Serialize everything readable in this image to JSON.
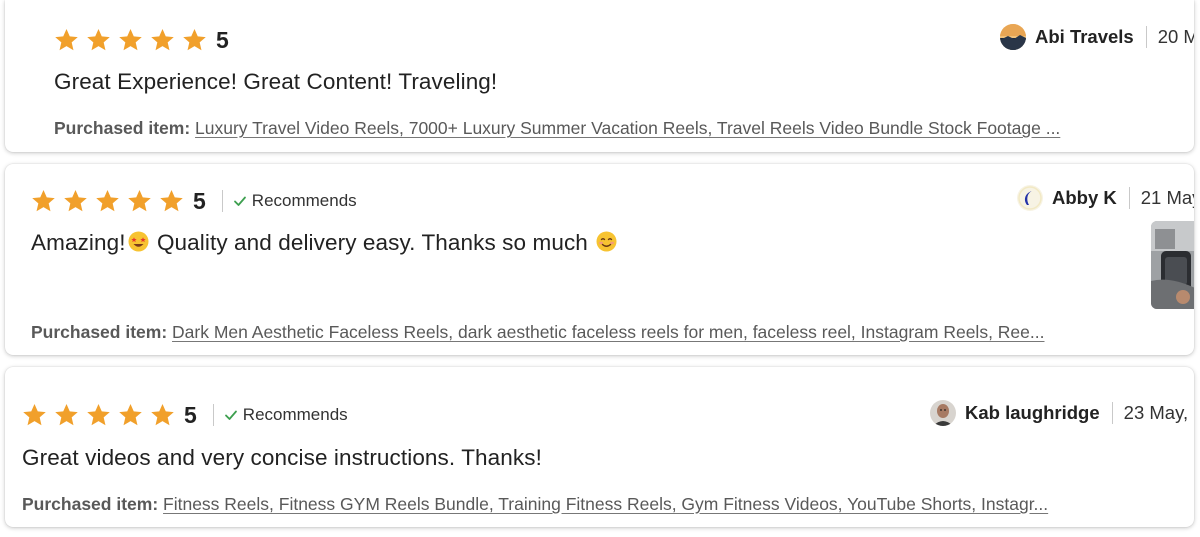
{
  "colors": {
    "star": "#F1A02B",
    "check": "#3d9f4f",
    "card_border": "#e1e1e1"
  },
  "icons": {
    "star": "star-icon",
    "check": "check-icon",
    "emoji_star_eyes": "star-struck-emoji-icon",
    "emoji_smile": "smiling-face-emoji-icon"
  },
  "reviews": [
    {
      "rating": 5,
      "rating_label": "5",
      "recommends": "",
      "text": "Great Experience! Great Content! Traveling!",
      "purchased_label": "Purchased item:",
      "purchased_item": "Luxury Travel Video Reels, 7000+ Luxury Summer Vacation Reels, Travel Reels Video Bundle Stock Footage ...",
      "reviewer": "Abi Travels",
      "date": "20 M"
    },
    {
      "rating": 5,
      "rating_label": "5",
      "recommends": "Recommends",
      "text_part1": "Amazing!",
      "text_part2": " Quality and delivery easy. Thanks so much ",
      "purchased_label": "Purchased item:",
      "purchased_item": "Dark Men Aesthetic Faceless Reels, dark aesthetic faceless reels for men, faceless reel, Instagram Reels, Ree...",
      "reviewer": "Abby K",
      "date": "21 May"
    },
    {
      "rating": 5,
      "rating_label": "5",
      "recommends": "Recommends",
      "text": "Great videos and very concise instructions. Thanks!",
      "purchased_label": "Purchased item:",
      "purchased_item": "Fitness Reels, Fitness GYM Reels Bundle, Training Fitness Reels, Gym Fitness Videos, YouTube Shorts, Instagr...",
      "reviewer": "Kab laughridge",
      "date": "23 May,"
    }
  ]
}
